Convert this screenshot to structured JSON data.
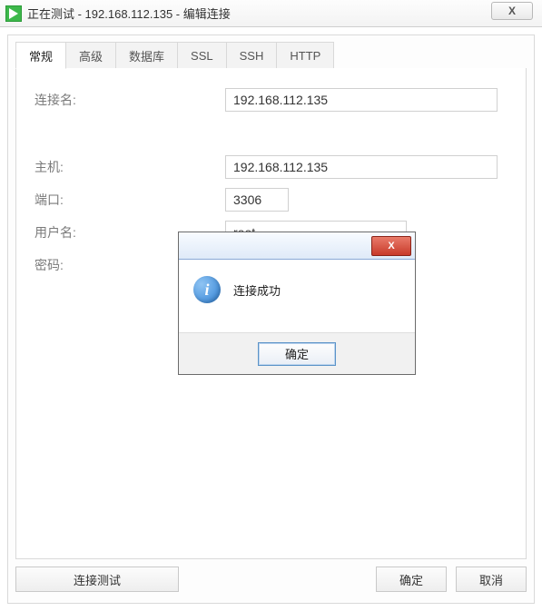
{
  "window": {
    "title": "正在测试 - 192.168.112.135 - 编辑连接",
    "close_glyph": "X"
  },
  "tabs": {
    "general": "常规",
    "advanced": "高级",
    "database": "数据库",
    "ssl": "SSL",
    "ssh": "SSH",
    "http": "HTTP"
  },
  "form": {
    "conn_name_label": "连接名:",
    "conn_name_value": "192.168.112.135",
    "host_label": "主机:",
    "host_value": "192.168.112.135",
    "port_label": "端口:",
    "port_value": "3306",
    "user_label": "用户名:",
    "user_value": "root",
    "pass_label": "密码:",
    "pass_value": ""
  },
  "buttons": {
    "test": "连接测试",
    "ok": "确定",
    "cancel": "取消"
  },
  "message": {
    "text": "连接成功",
    "ok": "确定",
    "close_glyph": "X",
    "info_glyph": "i"
  }
}
